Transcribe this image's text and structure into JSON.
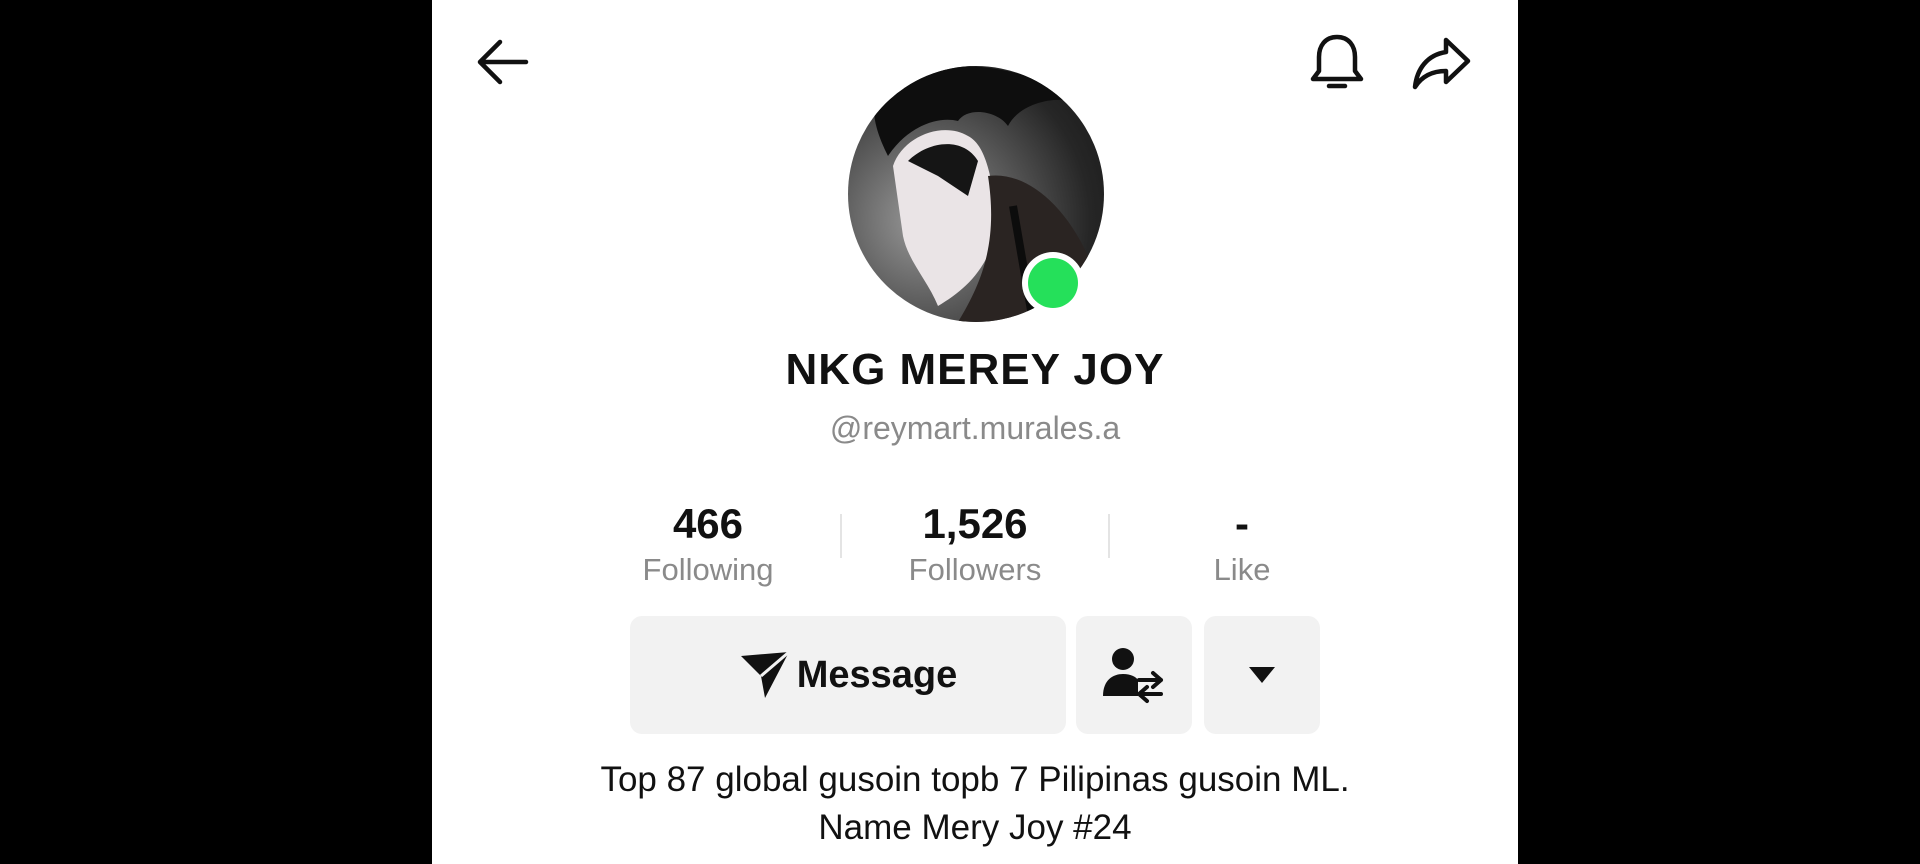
{
  "header": {
    "back_icon": "arrow-left-icon",
    "bell_icon": "bell-icon",
    "share_icon": "share-arrow-icon"
  },
  "profile": {
    "display_name": "NKG MEREY JOY",
    "handle": "@reymart.murales.a",
    "online_color": "#25e05a"
  },
  "stats": [
    {
      "value": "466",
      "label": "Following"
    },
    {
      "value": "1,526",
      "label": "Followers"
    },
    {
      "value": "-",
      "label": "Like"
    }
  ],
  "actions": {
    "message_label": "Message",
    "message_icon": "paper-plane-icon",
    "friend_icon": "person-swap-icon",
    "more_icon": "caret-down-icon"
  },
  "bio": {
    "line1": "Top 87 global gusoin topb 7 Pilipinas gusoin ML.",
    "line2": "Name Mery Joy #24"
  }
}
